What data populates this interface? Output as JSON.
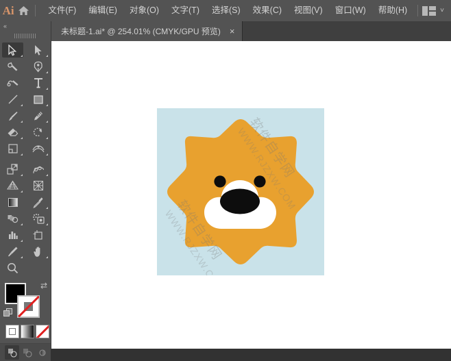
{
  "app": {
    "logo_text": "Ai",
    "home_icon": "home-icon",
    "workspace_icon": "workspace-switcher-icon",
    "workspace_chevron": "˅"
  },
  "menubar": {
    "items": [
      {
        "label": "文件(F)",
        "name": "menu-file"
      },
      {
        "label": "编辑(E)",
        "name": "menu-edit"
      },
      {
        "label": "对象(O)",
        "name": "menu-object"
      },
      {
        "label": "文字(T)",
        "name": "menu-type"
      },
      {
        "label": "选择(S)",
        "name": "menu-select"
      },
      {
        "label": "效果(C)",
        "name": "menu-effect"
      },
      {
        "label": "视图(V)",
        "name": "menu-view"
      },
      {
        "label": "窗口(W)",
        "name": "menu-window"
      },
      {
        "label": "帮助(H)",
        "name": "menu-help"
      }
    ]
  },
  "tabbar": {
    "document_tab": {
      "label": "未标题-1.ai* @ 254.01% (CMYK/GPU 预览)",
      "close_glyph": "×"
    }
  },
  "toolbar": {
    "collapse_glyph": "«",
    "tools": [
      {
        "name": "selection-tool",
        "label": "选择工具",
        "active": true,
        "has_flyout": true
      },
      {
        "name": "direct-selection-tool",
        "label": "直接选择工具",
        "active": false,
        "has_flyout": true
      },
      {
        "name": "magic-wand-tool",
        "label": "魔棒工具",
        "active": false,
        "has_flyout": false
      },
      {
        "name": "pen-tool",
        "label": "钢笔工具",
        "active": false,
        "has_flyout": true
      },
      {
        "name": "curvature-tool",
        "label": "曲率工具",
        "active": false,
        "has_flyout": false
      },
      {
        "name": "type-tool",
        "label": "文字工具",
        "active": false,
        "has_flyout": true
      },
      {
        "name": "line-segment-tool",
        "label": "直线段工具",
        "active": false,
        "has_flyout": true
      },
      {
        "name": "rectangle-tool",
        "label": "矩形工具",
        "active": false,
        "has_flyout": true
      },
      {
        "name": "paintbrush-tool",
        "label": "画笔工具",
        "active": false,
        "has_flyout": true
      },
      {
        "name": "shaper-tool",
        "label": "Shaper 工具",
        "active": false,
        "has_flyout": true
      },
      {
        "name": "eraser-tool",
        "label": "橡皮擦工具",
        "active": false,
        "has_flyout": true
      },
      {
        "name": "rotate-tool",
        "label": "旋转工具",
        "active": false,
        "has_flyout": true
      },
      {
        "name": "scale-tool",
        "label": "缩放工具",
        "active": false,
        "has_flyout": true
      },
      {
        "name": "width-tool",
        "label": "宽度工具",
        "active": false,
        "has_flyout": true
      },
      {
        "name": "free-transform-tool",
        "label": "自由变换工具",
        "active": false,
        "has_flyout": true
      },
      {
        "name": "shape-builder-tool",
        "label": "形状生成器工具",
        "active": false,
        "has_flyout": true
      },
      {
        "name": "perspective-grid-tool",
        "label": "透视网格工具",
        "active": false,
        "has_flyout": true
      },
      {
        "name": "mesh-tool",
        "label": "网格工具",
        "active": false,
        "has_flyout": false
      },
      {
        "name": "gradient-tool",
        "label": "渐变工具",
        "active": false,
        "has_flyout": false
      },
      {
        "name": "eyedropper-tool",
        "label": "吸管工具",
        "active": false,
        "has_flyout": true
      },
      {
        "name": "blend-tool",
        "label": "混合工具",
        "active": false,
        "has_flyout": true
      },
      {
        "name": "symbol-sprayer-tool",
        "label": "符号喷枪工具",
        "active": false,
        "has_flyout": true
      },
      {
        "name": "column-graph-tool",
        "label": "柱形图工具",
        "active": false,
        "has_flyout": true
      },
      {
        "name": "artboard-tool",
        "label": "画板工具",
        "active": false,
        "has_flyout": false
      },
      {
        "name": "slice-tool",
        "label": "切片工具",
        "active": false,
        "has_flyout": true
      },
      {
        "name": "hand-tool",
        "label": "抓手工具",
        "active": false,
        "has_flyout": true
      },
      {
        "name": "zoom-tool",
        "label": "缩放工具",
        "active": false,
        "has_flyout": false
      }
    ],
    "color_controls": {
      "fill_color": "#000000",
      "fill_name": "fill-swatch",
      "stroke_color": "#ffffff",
      "stroke_is_none": true,
      "stroke_name": "stroke-swatch",
      "swap_glyph": "⇄",
      "default_swatch_name": "default-fill-stroke"
    },
    "paint_modes": [
      {
        "name": "color-mode-button",
        "label": "颜色"
      },
      {
        "name": "gradient-mode-button",
        "label": "渐变"
      },
      {
        "name": "none-mode-button",
        "label": "无"
      }
    ],
    "draw_modes": [
      {
        "name": "draw-normal-button",
        "label": "正常绘图",
        "active": true
      },
      {
        "name": "draw-behind-button",
        "label": "背面绘图",
        "active": false
      },
      {
        "name": "draw-inside-button",
        "label": "内部绘图",
        "active": false
      }
    ]
  },
  "canvas": {
    "background": "#ffffff",
    "artboard": {
      "name": "artboard",
      "background_color": "#c9e2e9",
      "artwork": {
        "name": "lion-sunburst-artwork",
        "burst_color": "#e8a12f",
        "muzzle_color": "#ffffff",
        "eye_color": "#0d0d0d",
        "nose_color": "#0d0d0d"
      },
      "watermark": {
        "line1": "软件自学网",
        "line2": "WWW.RJZXW.COM"
      }
    }
  }
}
